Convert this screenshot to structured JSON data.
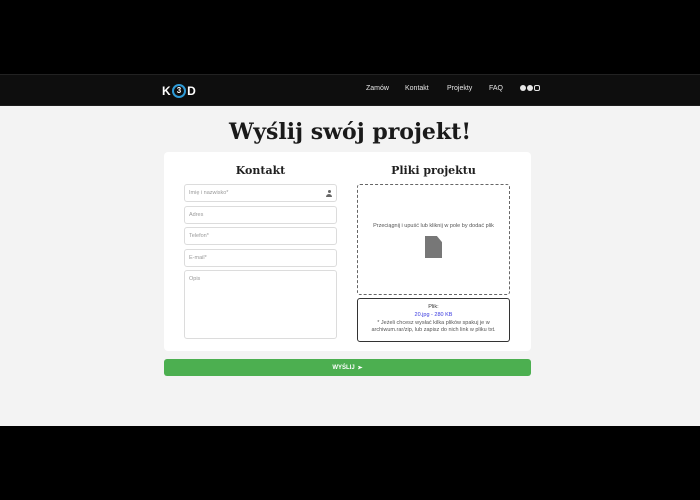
{
  "header": {
    "logo": {
      "left": "K",
      "ring": "3",
      "right": "D"
    },
    "nav": [
      {
        "label": "Zamów"
      },
      {
        "label": "Kontakt"
      },
      {
        "label": "Projekty"
      },
      {
        "label": "FAQ"
      }
    ],
    "social": [
      "facebook-icon",
      "github-icon",
      "instagram-icon"
    ]
  },
  "main": {
    "title": "Wyślij swój projekt!",
    "contact": {
      "heading": "Kontakt",
      "name_placeholder": "Imię i nazwisko*",
      "address_placeholder": "Adres",
      "phone_placeholder": "Telefon*",
      "email_placeholder": "E-mail*",
      "description_placeholder": "Opis"
    },
    "files": {
      "heading": "Pliki projektu",
      "dropzone_text": "Przeciągnij i upuść lub kliknij w pole by dodać plik",
      "file_label": "Plik:",
      "file_entry": "20.jpg - 280 KB",
      "note": "* Jeżeli chcesz wysłać kilka plików spakuj je w archiwum.rar/zip, lub zapisz do nich link w pliku txt."
    },
    "send_label": "WYŚLIJ"
  },
  "colors": {
    "accent": "#4caf50",
    "logo_ring": "#2f9bd7",
    "file_link": "#3a3adf",
    "navbar": "#0e0e0e"
  }
}
